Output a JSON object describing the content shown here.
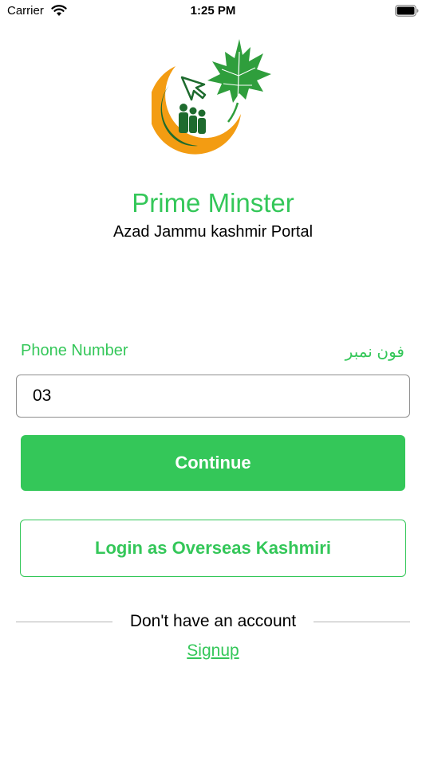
{
  "status_bar": {
    "carrier": "Carrier",
    "time": "1:25 PM"
  },
  "branding": {
    "title": "Prime Minster",
    "subtitle": "Azad Jammu kashmir Portal"
  },
  "form": {
    "phone_label_en": "Phone Number",
    "phone_label_ur": "فون نمبر",
    "phone_value": "03"
  },
  "actions": {
    "continue_label": "Continue",
    "overseas_label": "Login as Overseas Kashmiri"
  },
  "footer": {
    "no_account_text": "Don't have an account",
    "signup_label": "Signup"
  },
  "colors": {
    "accent_green": "#34c759",
    "logo_orange": "#f39c12",
    "logo_dark_green": "#1e6b2e"
  },
  "icons": {
    "wifi": "wifi-icon",
    "battery": "battery-icon",
    "logo": "kashmir-portal-logo"
  }
}
